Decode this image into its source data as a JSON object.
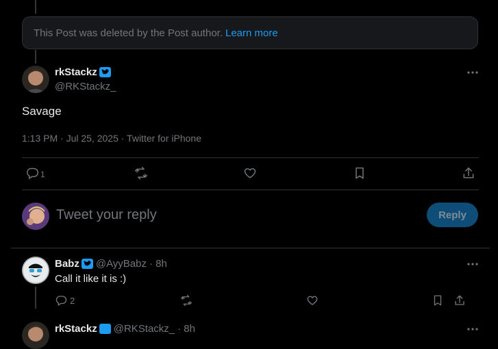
{
  "deleted_notice": {
    "text": "This Post was deleted by the Post author.",
    "link": "Learn more"
  },
  "main_post": {
    "author_name": "rkStackz",
    "author_handle": "@RKStackz_",
    "text": "Savage",
    "meta": "1:13 PM · Jul 25, 2025 · Twitter for iPhone",
    "reply_count": "1"
  },
  "composer": {
    "placeholder": "Tweet your reply",
    "reply_button": "Reply"
  },
  "replies": [
    {
      "author_name": "Babz",
      "author_handle": "@AyyBabz",
      "time": "· 8h",
      "text": "Call it like it is :)",
      "reply_count": "2"
    },
    {
      "author_name": "rkStackz",
      "author_handle": "@RKStackz_",
      "time": "· 8h"
    }
  ],
  "colors": {
    "accent": "#1d9bf0",
    "muted": "#71767b",
    "border": "#2f3336"
  }
}
